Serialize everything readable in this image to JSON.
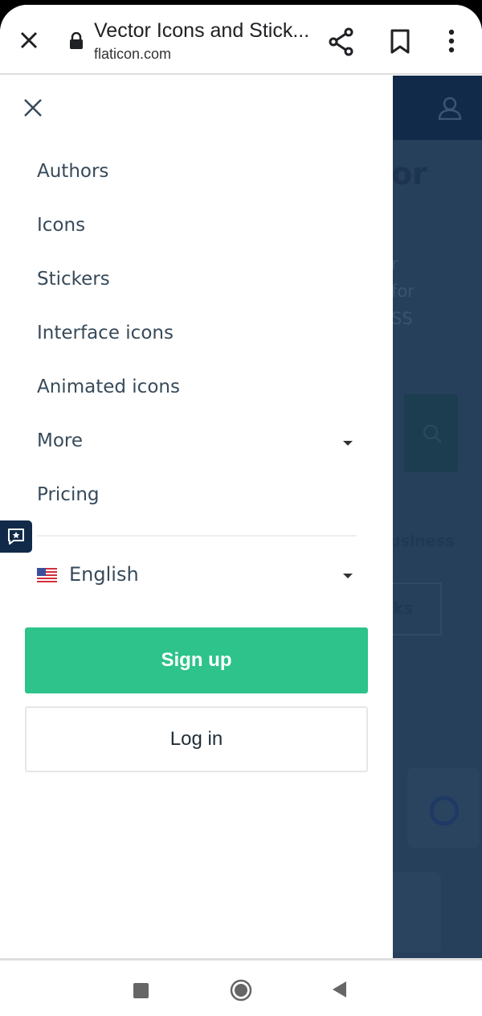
{
  "browser": {
    "page_title": "Vector Icons and Stick...",
    "url": "flaticon.com"
  },
  "background_fragments": {
    "heading": "or",
    "line1": "r",
    "line2": "for",
    "line3": "SS",
    "business": "usiness",
    "button": "ks"
  },
  "menu": {
    "items": [
      {
        "label": "Authors"
      },
      {
        "label": "Icons"
      },
      {
        "label": "Stickers"
      },
      {
        "label": "Interface icons"
      },
      {
        "label": "Animated icons"
      },
      {
        "label": "More",
        "has_dropdown": true
      },
      {
        "label": "Pricing"
      }
    ],
    "language": "English",
    "signup_label": "Sign up",
    "login_label": "Log in"
  },
  "colors": {
    "accent_green": "#2dc38b",
    "navy": "#112a49",
    "overlay": "#263f5a",
    "text": "#374a5a"
  }
}
